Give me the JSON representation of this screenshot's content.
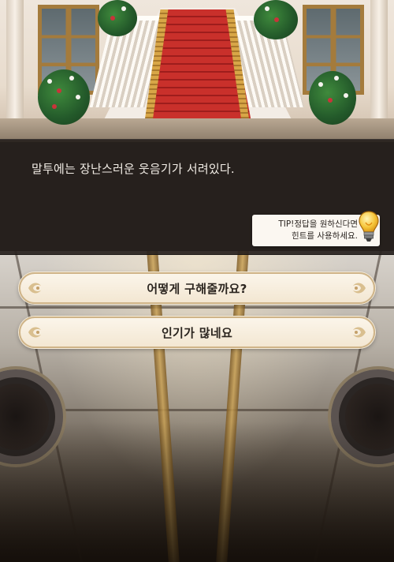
{
  "dialogue": {
    "text": "말투에는 장난스러운 웃음기가 서려있다."
  },
  "tip": {
    "line1": "TIP!정답을 원하신다면",
    "line2": "힌트를 사용하세요.",
    "icon": "lightbulb-icon"
  },
  "choices": [
    {
      "label": "어떻게 구해줄까요?"
    },
    {
      "label": "인기가 많네요"
    }
  ],
  "colors": {
    "dialogue_bg": "#28211e",
    "choice_bg": "#f7eedf",
    "choice_border": "#cfb488",
    "carpet": "#c9302b"
  }
}
